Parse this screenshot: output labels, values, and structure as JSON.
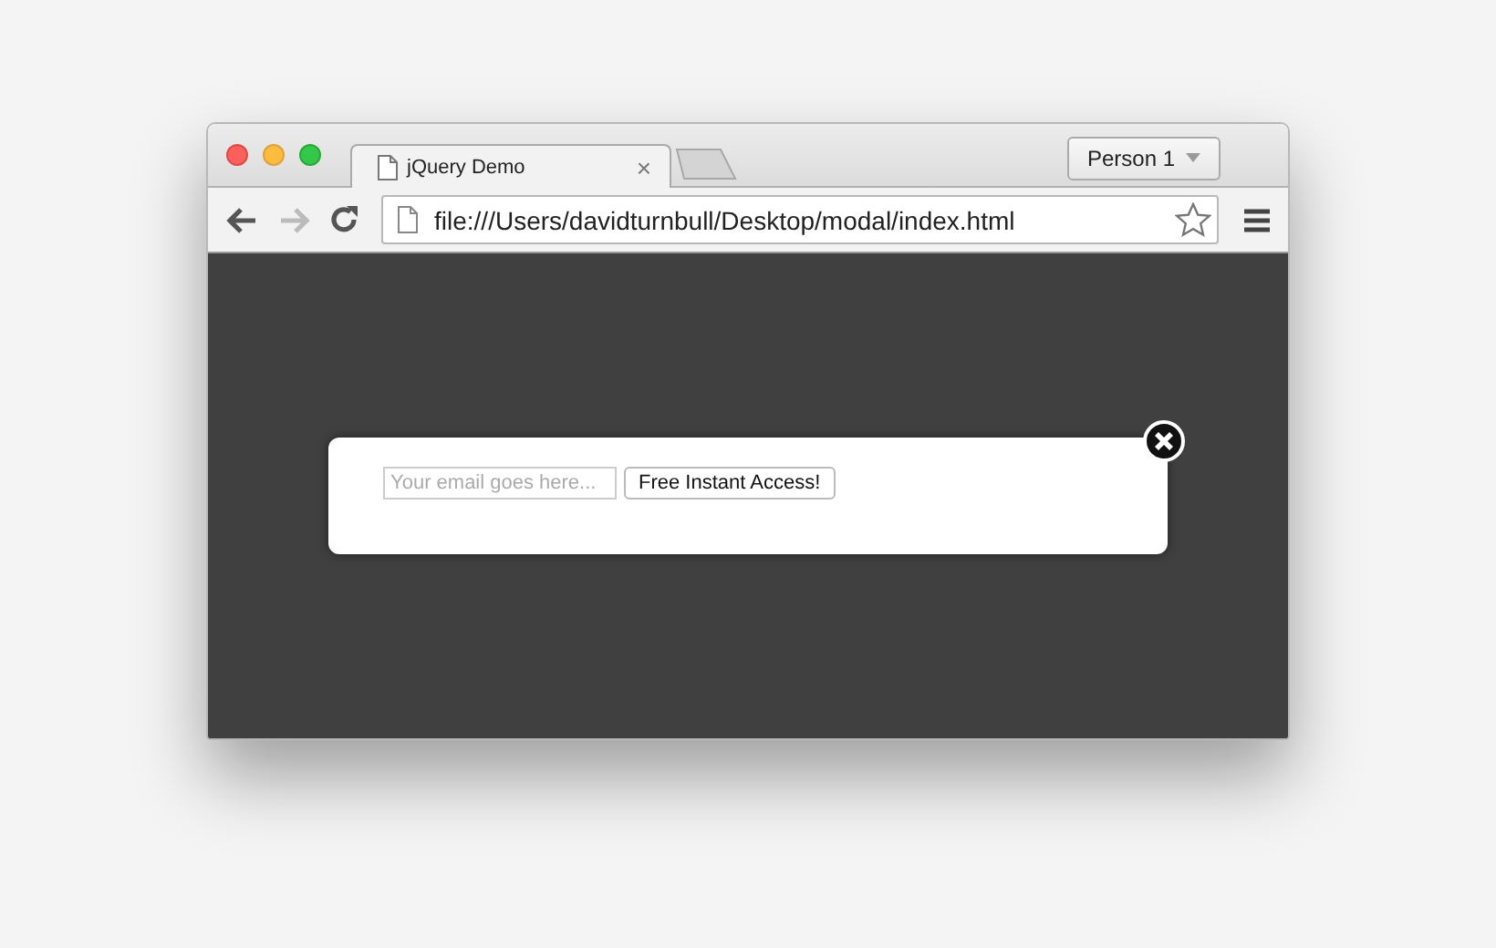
{
  "browser": {
    "tabs": [
      {
        "title": "jQuery Demo",
        "close": "×",
        "selected": true
      }
    ],
    "profile": "Person 1",
    "nav": [
      {
        "kind": "back",
        "disabled": false
      },
      {
        "kind": "forward",
        "disabled": true
      },
      {
        "kind": "reload",
        "disabled": false
      }
    ],
    "address": "file:///Users/davidturnbull/Desktop/modal/index.html"
  },
  "modal": {
    "email_field": {
      "placeholder": "Your email goes here..."
    },
    "button": "Free Instant Access!"
  }
}
